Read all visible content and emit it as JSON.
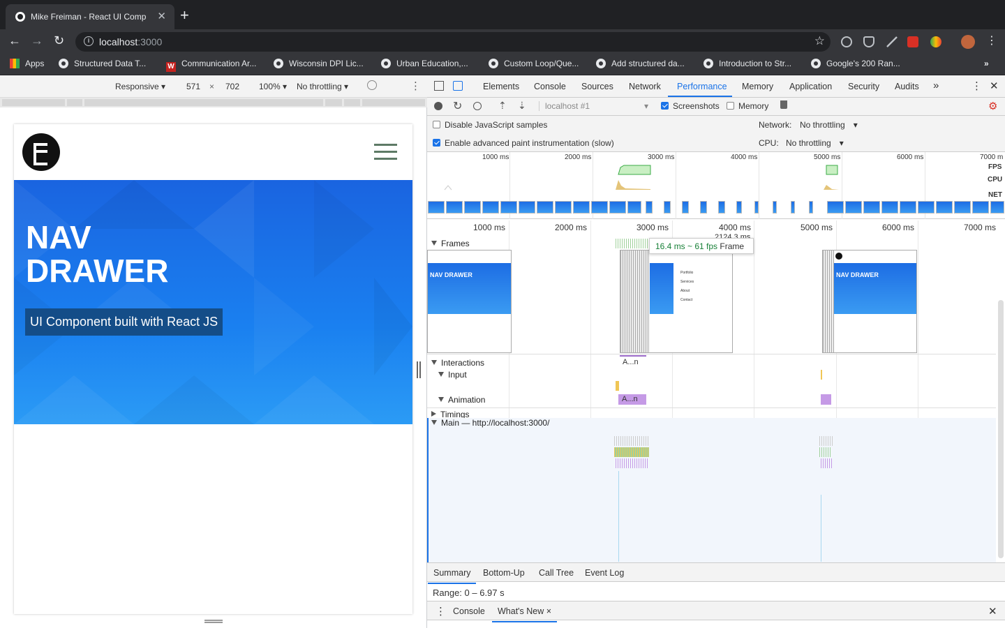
{
  "browser": {
    "tab_title": "Mike Freiman - React UI Comp",
    "url_host": "localhost",
    "url_port": ":3000",
    "bookmarks": [
      "Apps",
      "Structured Data T...",
      "Communication Ar...",
      "Wisconsin DPI Lic...",
      "Urban Education,...",
      "Custom Loop/Que...",
      "Add structured da...",
      "Introduction to Str...",
      "Google's 200 Ran..."
    ]
  },
  "device_toolbar": {
    "mode": "Responsive ▾",
    "width": "571",
    "times": "×",
    "height": "702",
    "zoom": "100% ▾",
    "throttle": "No throttling ▾"
  },
  "site": {
    "hero_line1": "NAV",
    "hero_line2": "DRAWER",
    "hero_subtitle": "UI Component built with React JS"
  },
  "devtools": {
    "tabs": [
      "Elements",
      "Console",
      "Sources",
      "Network",
      "Performance",
      "Memory",
      "Application",
      "Security",
      "Audits"
    ],
    "more": "»",
    "active_tab": "Performance",
    "recording_select": "localhost #1",
    "screenshots_label": "Screenshots",
    "memory_label": "Memory",
    "disable_js_samples": "Disable JavaScript samples",
    "advanced_paint": "Enable advanced paint instrumentation (slow)",
    "network_label": "Network:",
    "network_value": "No throttling",
    "cpu_label": "CPU:",
    "cpu_value": "No throttling",
    "overview_ticks": [
      "1000 ms",
      "2000 ms",
      "3000 ms",
      "4000 ms",
      "5000 ms",
      "6000 ms",
      "7000 m"
    ],
    "overview_rows": [
      "FPS",
      "CPU",
      "NET"
    ],
    "timeline_ticks": [
      "1000 ms",
      "2000 ms",
      "3000 ms",
      "4000 ms",
      "5000 ms",
      "6000 ms",
      "7000 ms"
    ],
    "tracks": {
      "frames": "Frames",
      "interactions": "Interactions",
      "input": "Input",
      "animation": "Animation",
      "animation_short": "A...n",
      "timings": "Timings",
      "main": "Main — http://localhost:3000/"
    },
    "frame_label_partial": "2124.3 ms",
    "screenshot_title_1": "NAV DRAWER",
    "screenshot_menu": [
      "Portfolio",
      "Services",
      "About",
      "Contact"
    ],
    "tooltip": {
      "fps": "16.4 ms ~ 61 fps",
      "label": "Frame"
    },
    "bottom_tabs": [
      "Summary",
      "Bottom-Up",
      "Call Tree",
      "Event Log"
    ],
    "range": "Range: 0 – 6.97 s",
    "drawer_tabs": [
      "Console",
      "What's New"
    ],
    "drawer_close": "×"
  }
}
